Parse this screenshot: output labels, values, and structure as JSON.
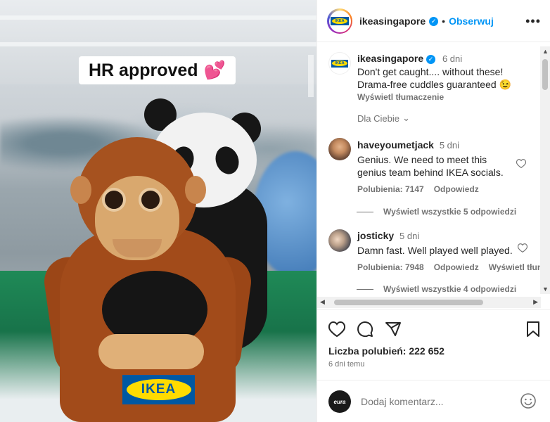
{
  "post_image": {
    "sticker_text": "HR approved",
    "sticker_emoji": "💕",
    "logo_text": "IKEA"
  },
  "header": {
    "username": "ikeasingapore",
    "follow_label": "Obserwuj",
    "more_label": "•••"
  },
  "caption": {
    "username": "ikeasingapore",
    "time": "6 dni",
    "line1": "Don't get caught.... without these!",
    "line2": "Drama-free cuddles guaranteed 😉",
    "translate_label": "Wyświetl tłumaczenie"
  },
  "sort": {
    "label": "Dla Ciebie"
  },
  "comments": [
    {
      "username": "haveyoumetjack",
      "time": "5 dni",
      "text_line1": "Genius. We need to meet this",
      "text_line2": "genius team behind IKEA socials.",
      "likes": "Polubienia: 7147",
      "reply_label": "Odpowiedz",
      "view_replies": "Wyświetl wszystkie 5 odpowiedzi"
    },
    {
      "username": "josticky",
      "time": "5 dni",
      "text_line1": "Damn fast. Well played well played.",
      "likes": "Polubienia: 7948",
      "reply_label": "Odpowiedz",
      "translate_label": "Wyświetl tłuma",
      "view_replies": "Wyświetl wszystkie 4 odpowiedzi"
    }
  ],
  "footer": {
    "likes_label": "Liczba polubień: 222 652",
    "time_ago": "6 dni temu",
    "comment_placeholder": "Dodaj komentarz...",
    "current_user_badge": "eura"
  },
  "colors": {
    "accent": "#0095f6",
    "ikea_blue": "#0058a3",
    "ikea_yellow": "#ffdb00",
    "muted_text": "#737373"
  },
  "icons": [
    "heart-icon",
    "comment-icon",
    "share-icon",
    "bookmark-icon",
    "emoji-icon",
    "verified-badge-icon",
    "chevron-down-icon"
  ]
}
